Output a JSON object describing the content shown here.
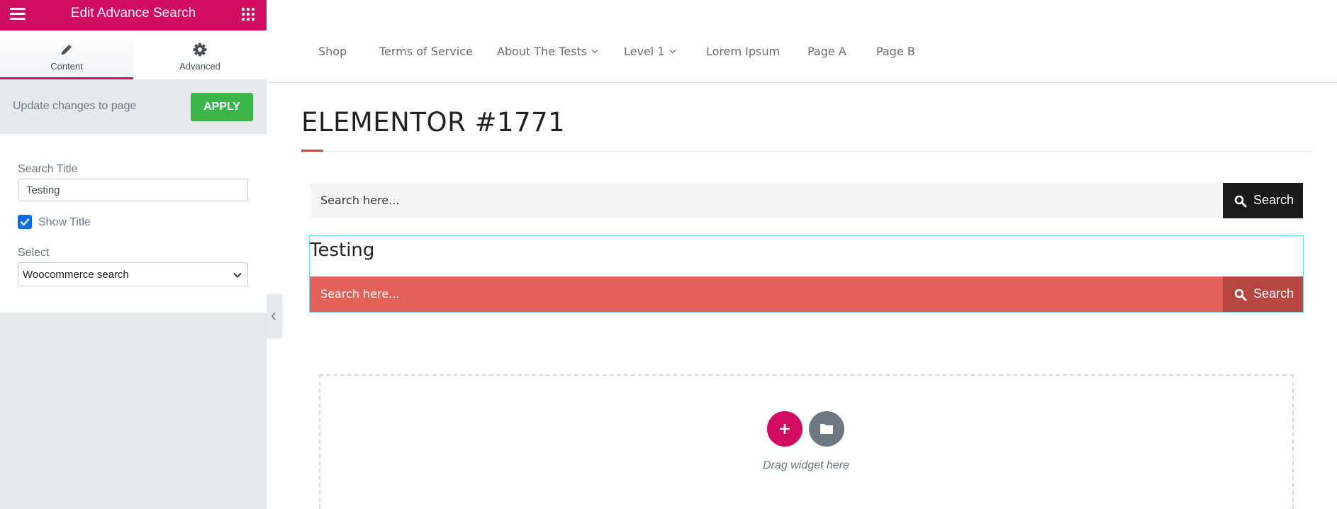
{
  "panel": {
    "title": "Edit Advance Search",
    "tabs": [
      {
        "label": "Content",
        "icon": "pencil-icon",
        "active": true
      },
      {
        "label": "Advanced",
        "icon": "gear-icon",
        "active": false
      }
    ],
    "apply_text": "Update changes to page",
    "apply_label": "APPLY",
    "search_title_label": "Search Title",
    "search_title_value": "Testing",
    "show_title_label": "Show Title",
    "show_title_checked": true,
    "select_label": "Select",
    "select_value": "Woocommerce search",
    "colors": {
      "brand": "#d10a62",
      "apply": "#39b54a",
      "checkbox": "#0b6ce8"
    }
  },
  "nav": {
    "items": [
      {
        "label": "Shop",
        "dropdown": false
      },
      {
        "label": "Terms of Service",
        "dropdown": false
      },
      {
        "label": "About The Tests",
        "dropdown": true
      },
      {
        "label": "Level 1",
        "dropdown": true
      },
      {
        "label": "Lorem Ipsum",
        "dropdown": false
      },
      {
        "label": "Page A",
        "dropdown": false
      },
      {
        "label": "Page B",
        "dropdown": false
      }
    ]
  },
  "page": {
    "title": "ELEMENTOR #1771",
    "search1": {
      "placeholder": "Search here...",
      "button_label": "Search",
      "button_color": "#1a1a1a"
    },
    "widget_title": "Testing",
    "search2": {
      "placeholder": "Search here...",
      "button_label": "Search",
      "field_color": "#e2625a",
      "button_color": "#b84640"
    },
    "drop_label": "Drag widget here",
    "accent_color": "#e2403f"
  }
}
